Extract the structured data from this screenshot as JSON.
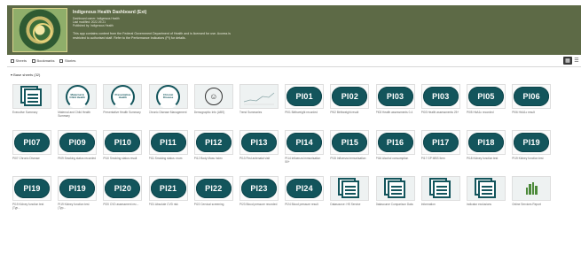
{
  "header": {
    "title": "Indigenous Health Dashboard (Ext)",
    "meta_lines": [
      "Dashboard owner: Indigenous Health",
      "Last modified: 2022-09-21",
      "Published by: Indigenous Health"
    ],
    "description": "This app contains content from the Federal Government Department of Health and is licensed for use. Access is restricted to authorised staff. Refer to the Performance Indicators (PI) for details."
  },
  "toolbar": {
    "sheets_label": "Sheets",
    "bookmarks_label": "Bookmarks",
    "stories_label": "Stories"
  },
  "section": {
    "label": "Base sheets (32)"
  },
  "tiles": [
    {
      "kind": "doc",
      "label": "",
      "caption": "Executive Summary"
    },
    {
      "kind": "circle",
      "label": "Maternal & Child Health",
      "caption": "Maternal and Child Health Summary"
    },
    {
      "kind": "circle",
      "label": "Preventative Health",
      "caption": "Preventative Health Summary"
    },
    {
      "kind": "circle",
      "label": "Chronic Disease",
      "caption": "Chronic Disease Management"
    },
    {
      "kind": "face",
      "label": "",
      "caption": "Demographic Info (ABS)"
    },
    {
      "kind": "line",
      "label": "",
      "caption": "Trend Summaries"
    },
    {
      "kind": "pill",
      "label": "PI01",
      "caption": "PI01 Birthweight recorded"
    },
    {
      "kind": "pill",
      "label": "PI02",
      "caption": "PI02 Birthweight result"
    },
    {
      "kind": "pill",
      "label": "PI03",
      "caption": "PI03 Health assessments 0-4"
    },
    {
      "kind": "pill",
      "label": "PI03",
      "caption": "PI03 Health assessments 25+"
    },
    {
      "kind": "pill",
      "label": "PI05",
      "caption": "PI05 HbA1c recorded"
    },
    {
      "kind": "pill",
      "label": "PI06",
      "caption": "PI06 HbA1c result"
    },
    {
      "kind": "pill",
      "label": "PI07",
      "caption": "PI07 Chronic Disease"
    },
    {
      "kind": "pill",
      "label": "PI09",
      "caption": "PI09 Smoking status recorded"
    },
    {
      "kind": "pill",
      "label": "PI10",
      "caption": "PI10 Smoking status result"
    },
    {
      "kind": "pill",
      "label": "PI11",
      "caption": "PI11 Smoking status: mum"
    },
    {
      "kind": "pill",
      "label": "PI12",
      "caption": "PI12 Body Mass Index"
    },
    {
      "kind": "pill",
      "label": "PI13",
      "caption": "PI13 First antenatal visit"
    },
    {
      "kind": "pill",
      "label": "PI14",
      "caption": "PI14 Influenza immunisation 50+"
    },
    {
      "kind": "pill",
      "label": "PI15",
      "caption": "PI15 Influenza immunisation"
    },
    {
      "kind": "pill",
      "label": "PI16",
      "caption": "PI16 Alcohol consumption"
    },
    {
      "kind": "pill",
      "label": "PI17",
      "caption": "PI17 GP MBS Item"
    },
    {
      "kind": "pill",
      "label": "PI18",
      "caption": "PI18 Kidney function test"
    },
    {
      "kind": "pill",
      "label": "PI19",
      "caption": "PI19 Kidney function test"
    },
    {
      "kind": "pill",
      "label": "PI19",
      "caption": "PI19 Kidney function test (Typ..."
    },
    {
      "kind": "pill",
      "label": "PI19",
      "caption": "PI19 Kidney function test (Typ..."
    },
    {
      "kind": "pill",
      "label": "PI20",
      "caption": "PI20 CVD assessment rec..."
    },
    {
      "kind": "pill",
      "label": "PI21",
      "caption": "PI21 Absolute CVD risk"
    },
    {
      "kind": "pill",
      "label": "PI22",
      "caption": "PI22 Cervical screening"
    },
    {
      "kind": "pill",
      "label": "PI23",
      "caption": "PI23 Blood pressure recorded"
    },
    {
      "kind": "pill",
      "label": "PI24",
      "caption": "PI24 Blood pressure result"
    },
    {
      "kind": "doc",
      "label": "",
      "caption": "Datasource: HS Service"
    },
    {
      "kind": "doc",
      "label": "",
      "caption": "Datasource Comparison Data"
    },
    {
      "kind": "doc",
      "label": "",
      "caption": "Information"
    },
    {
      "kind": "doc",
      "label": "",
      "caption": "Indicator exclusions"
    },
    {
      "kind": "bars",
      "label": "",
      "caption": "Online Services Report"
    }
  ],
  "colors": {
    "banner": "#5d6a46",
    "pill": "#13555c"
  }
}
